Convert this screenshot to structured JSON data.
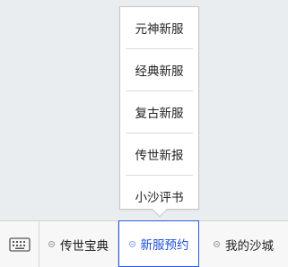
{
  "popup_menu": {
    "items": [
      {
        "label": "元神新服"
      },
      {
        "label": "经典新服"
      },
      {
        "label": "复古新服"
      },
      {
        "label": "传世新报"
      },
      {
        "label": "小沙评书"
      }
    ]
  },
  "bottom_bar": {
    "keyboard_icon": "keyboard-icon",
    "tabs": [
      {
        "label": "传世宝典",
        "active": false
      },
      {
        "label": "新服预约",
        "active": true
      },
      {
        "label": "我的沙城",
        "active": false
      }
    ]
  },
  "colors": {
    "active_accent": "#2c5ce3",
    "background": "#e9edef"
  }
}
